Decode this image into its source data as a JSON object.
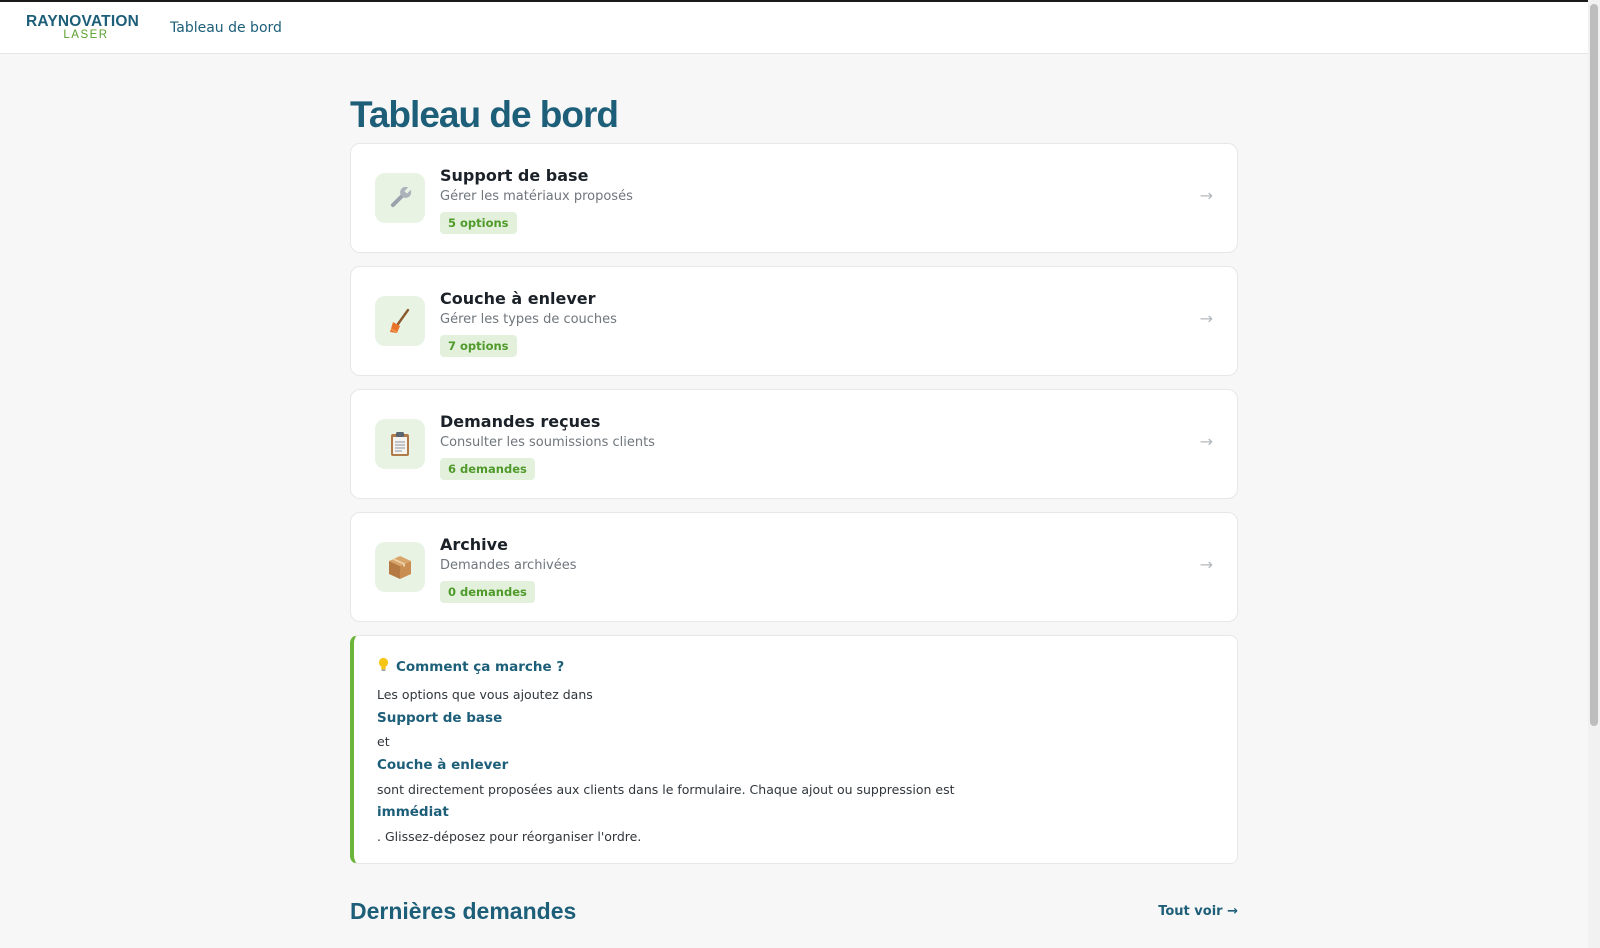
{
  "header": {
    "logo_top": "RAYNOVATION",
    "logo_bottom": "LASER",
    "nav_label": "Tableau de bord"
  },
  "page": {
    "title": "Tableau de bord"
  },
  "cards": [
    {
      "title": "Support de base",
      "subtitle": "Gérer les matériaux proposés",
      "badge": "5 options",
      "icon": "wrench-icon",
      "arrow": "→"
    },
    {
      "title": "Couche à enlever",
      "subtitle": "Gérer les types de couches",
      "badge": "7 options",
      "icon": "broom-icon",
      "arrow": "→"
    },
    {
      "title": "Demandes reçues",
      "subtitle": "Consulter les soumissions clients",
      "badge": "6 demandes",
      "icon": "clipboard-icon",
      "arrow": "→"
    },
    {
      "title": "Archive",
      "subtitle": "Demandes archivées",
      "badge": "0 demandes",
      "icon": "package-icon",
      "arrow": "→"
    }
  ],
  "info": {
    "icon": "lightbulb-icon",
    "title": "Comment ça marche ?",
    "lines": [
      "Les options que vous ajoutez dans",
      "Support de base",
      "et",
      "Couche à enlever",
      "sont directement proposées aux clients dans le formulaire. Chaque ajout ou suppression est",
      "immédiat",
      ". Glissez-déposez pour réorganiser l'ordre."
    ]
  },
  "recent": {
    "title": "Dernières demandes",
    "see_all": "Tout voir →"
  },
  "colors": {
    "primary": "#1d5e79",
    "accent": "#6ab53a",
    "badge_bg": "#e3f1dc",
    "badge_text": "#4f9a2a"
  }
}
